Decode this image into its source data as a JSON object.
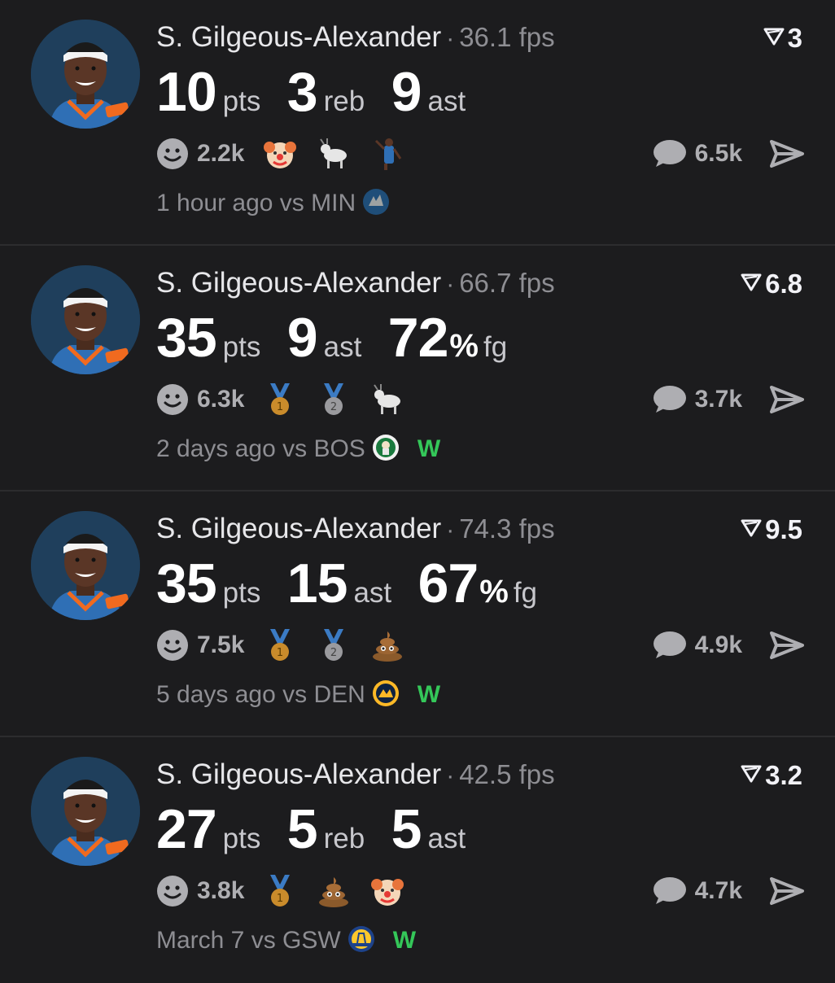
{
  "posts": [
    {
      "player": "S. Gilgeous-Alexander",
      "separator": "·",
      "fps": "36.1 fps",
      "rating": "3",
      "stats": [
        {
          "value": "10",
          "unit": "pts",
          "pct": ""
        },
        {
          "value": "3",
          "unit": "reb",
          "pct": ""
        },
        {
          "value": "9",
          "unit": "ast",
          "pct": ""
        }
      ],
      "reaction_count": "2.2k",
      "reactions": [
        "clown-icon",
        "goat-icon",
        "dunk-sticker-icon"
      ],
      "comments": "6.5k",
      "time": "1 hour ago vs MIN",
      "team_logo": "timberwolves-logo-icon",
      "result": ""
    },
    {
      "player": "S. Gilgeous-Alexander",
      "separator": "·",
      "fps": "66.7 fps",
      "rating": "6.8",
      "stats": [
        {
          "value": "35",
          "unit": "pts",
          "pct": ""
        },
        {
          "value": "9",
          "unit": "ast",
          "pct": ""
        },
        {
          "value": "72",
          "unit": "fg",
          "pct": "%"
        }
      ],
      "reaction_count": "6.3k",
      "reactions": [
        "gold-medal-icon",
        "silver-medal-icon",
        "goat-icon"
      ],
      "comments": "3.7k",
      "time": "2 days ago vs BOS",
      "team_logo": "celtics-logo-icon",
      "result": "W"
    },
    {
      "player": "S. Gilgeous-Alexander",
      "separator": "·",
      "fps": "74.3 fps",
      "rating": "9.5",
      "stats": [
        {
          "value": "35",
          "unit": "pts",
          "pct": ""
        },
        {
          "value": "15",
          "unit": "ast",
          "pct": ""
        },
        {
          "value": "67",
          "unit": "fg",
          "pct": "%"
        }
      ],
      "reaction_count": "7.5k",
      "reactions": [
        "gold-medal-icon",
        "silver-medal-icon",
        "poop-icon"
      ],
      "comments": "4.9k",
      "time": "5 days ago vs DEN",
      "team_logo": "nuggets-logo-icon",
      "result": "W"
    },
    {
      "player": "S. Gilgeous-Alexander",
      "separator": "·",
      "fps": "42.5 fps",
      "rating": "3.2",
      "stats": [
        {
          "value": "27",
          "unit": "pts",
          "pct": ""
        },
        {
          "value": "5",
          "unit": "reb",
          "pct": ""
        },
        {
          "value": "5",
          "unit": "ast",
          "pct": ""
        }
      ],
      "reaction_count": "3.8k",
      "reactions": [
        "gold-medal-icon",
        "poop-icon",
        "clown-icon"
      ],
      "comments": "4.7k",
      "time": "March 7 vs GSW",
      "team_logo": "warriors-logo-icon",
      "result": "W"
    }
  ],
  "colors": {
    "background": "#1c1c1e",
    "text_primary": "#ffffff",
    "text_secondary": "#8e8e93",
    "win": "#34c759",
    "divider": "#2c2c2e"
  }
}
